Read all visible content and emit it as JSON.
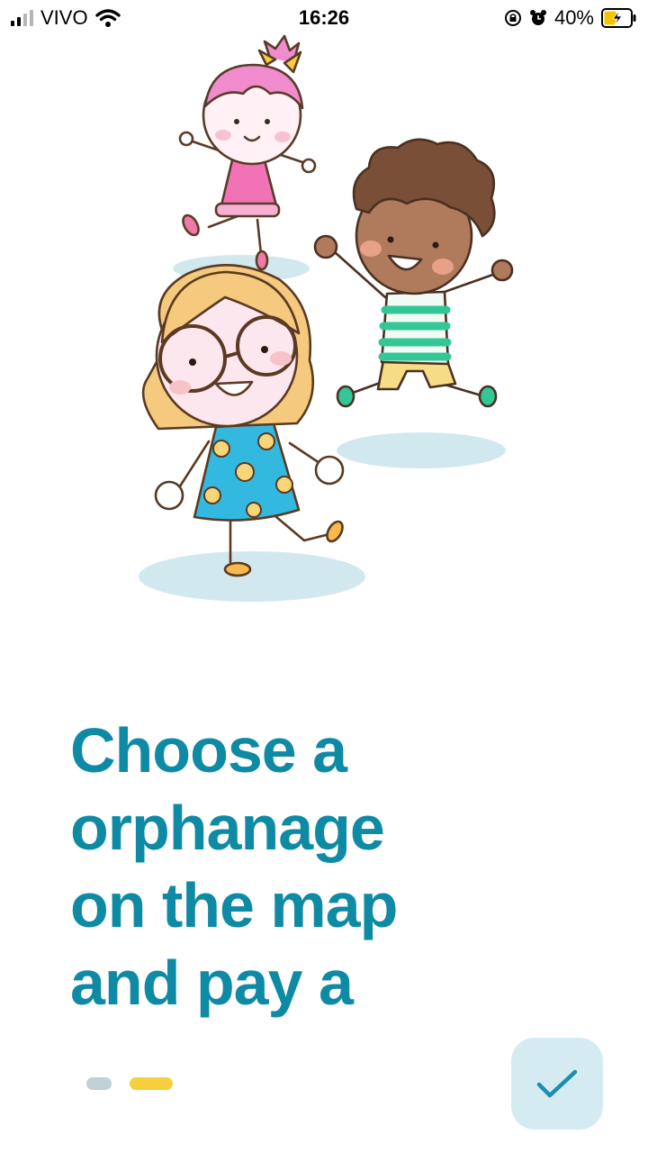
{
  "status_bar": {
    "carrier": "VIVO",
    "time": "16:26",
    "battery_percent": "40%",
    "icons": [
      "signal-icon",
      "wifi-icon",
      "rotation-lock-icon",
      "alarm-icon",
      "battery-charging-icon"
    ]
  },
  "onboarding": {
    "illustration": "children-jumping-illustration",
    "headline_lines": [
      "Choose a",
      "orphanage",
      "on the map",
      "and pay a"
    ],
    "page_indicator": {
      "total": 2,
      "active_index": 1
    },
    "done_button_icon": "checkmark-icon"
  },
  "colors": {
    "headline": "#0f8aa5",
    "indicator_active": "#f7cf3c",
    "indicator_inactive": "#c3cfd6",
    "done_button_bg": "#d4ecf1",
    "done_button_icon": "#1b8fb3"
  }
}
